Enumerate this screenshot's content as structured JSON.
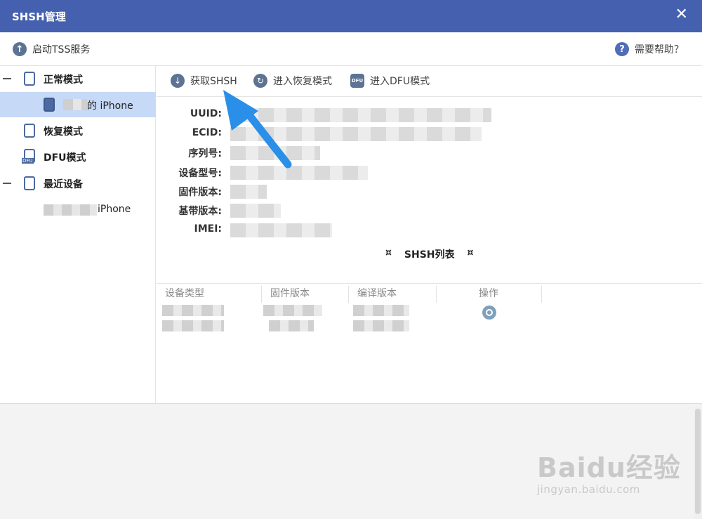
{
  "window": {
    "title": "SHSH管理",
    "close_glyph": "✕"
  },
  "topbar": {
    "tss_label": "启动TSS服务",
    "help_label": "需要帮助？"
  },
  "sidebar": {
    "normal_mode": "正常模式",
    "current_device": "的 iPhone",
    "recovery_mode": "恢复模式",
    "dfu_mode": "DFU模式",
    "recent_devices": "最近设备",
    "recent_device": "iPhone",
    "dfu_icon_tag": "DFU"
  },
  "toolbar": {
    "get_shsh": "获取SHSH",
    "enter_recovery": "进入恢复模式",
    "enter_dfu": "进入DFU模式"
  },
  "device_info": [
    {
      "key": "UUID:"
    },
    {
      "key": "ECID:"
    },
    {
      "key": "序列号:"
    },
    {
      "key": "设备型号:"
    },
    {
      "key": "固件版本:"
    },
    {
      "key": "基带版本:"
    },
    {
      "key": "IMEI:"
    }
  ],
  "shsh_list": {
    "title": "SHSH列表",
    "marker": "¤",
    "columns": [
      "设备类型",
      "固件版本",
      "编译版本",
      "操作"
    ]
  },
  "watermark": {
    "brand": "Baidu经验",
    "url": "jingyan.baidu.com"
  },
  "colors": {
    "titlebar": "#4560ae",
    "selected_row": "#c6d9f7",
    "arrow": "#2a8fe8"
  }
}
